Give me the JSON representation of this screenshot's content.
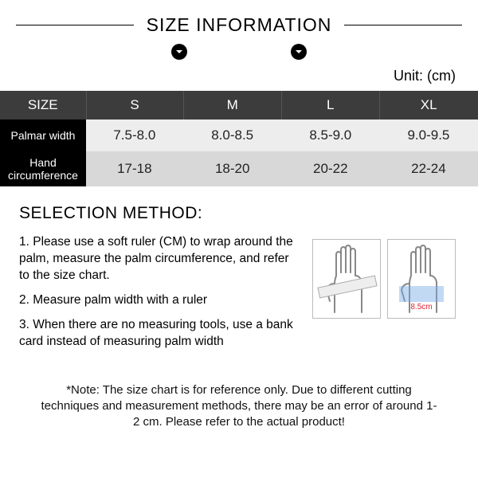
{
  "header": {
    "title": "SIZE INFORMATION",
    "unit_label": "Unit: (cm)"
  },
  "chart_data": {
    "type": "table",
    "title": "Size Information",
    "columns": [
      "SIZE",
      "S",
      "M",
      "L",
      "XL"
    ],
    "rows": [
      {
        "label": "Palmar width",
        "values": [
          "7.5-8.0",
          "8.0-8.5",
          "8.5-9.0",
          "9.0-9.5"
        ]
      },
      {
        "label": "Hand circumference",
        "values": [
          "17-18",
          "18-20",
          "20-22",
          "22-24"
        ]
      }
    ]
  },
  "method": {
    "heading": "SELECTION METHOD:",
    "steps": [
      "1. Please use a soft ruler (CM) to wrap around the palm, measure the palm circumference, and refer to the size chart.",
      "2. Measure palm width with a ruler",
      "3. When there are no measuring tools, use a bank card instead of measuring palm width"
    ],
    "illustration_width_label": "8.5cm"
  },
  "note": "*Note: The size chart is for reference only. Due to different cutting techniques and measurement methods, there may be an error of around 1-2 cm. Please refer to the actual product!"
}
